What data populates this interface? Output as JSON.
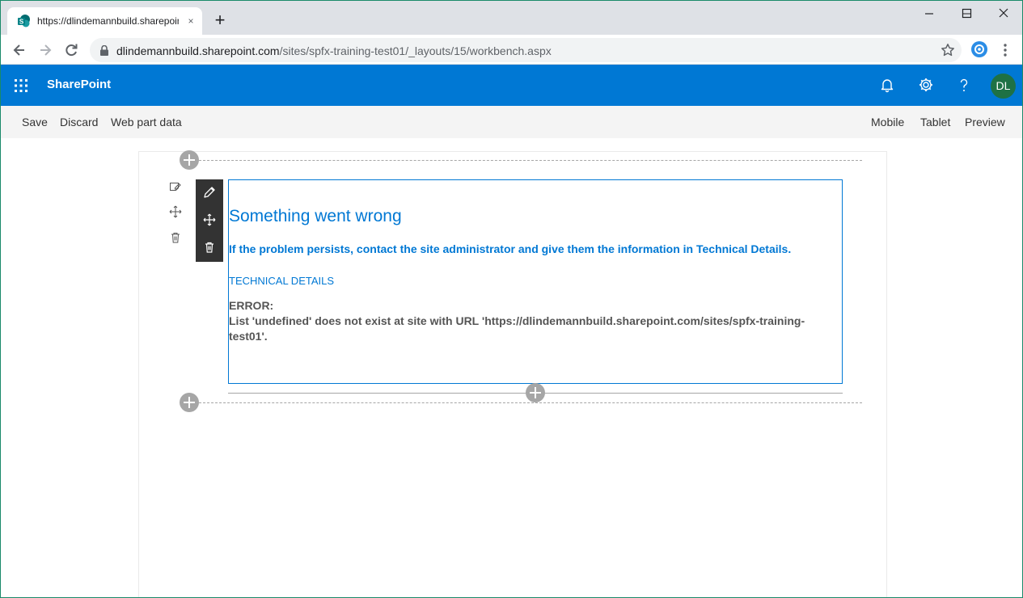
{
  "browser": {
    "tab_title": "https://dlindemannbuild.sharepoint.com/sites/spfx-training-test01/_layouts/15/workbench.aspx",
    "tab_close": "×",
    "new_tab": "+",
    "url_host": "dlindemannbuild.sharepoint.com",
    "url_path": "/sites/spfx-training-test01/_layouts/15/workbench.aspx",
    "window_controls": [
      "minimize",
      "maximize",
      "close"
    ],
    "favicon_letter": "S"
  },
  "suite": {
    "brand": "SharePoint",
    "avatar_initials": "DL",
    "accent": "#0078d4",
    "avatar_color": "#1e7145"
  },
  "commandbar": {
    "left": [
      "Save",
      "Discard",
      "Web part data"
    ],
    "right": [
      "Mobile",
      "Tablet",
      "Preview"
    ]
  },
  "webpart": {
    "title": "Something went wrong",
    "message": "If the problem persists, contact the site administrator and give them the information in Technical Details.",
    "technical_label": "TECHNICAL DETAILS",
    "error_label": "ERROR:",
    "error_detail": "List 'undefined' does not exist at site with URL 'https://dlindemannbuild.sharepoint.com/sites/spfx-training-test01'."
  },
  "icons": {
    "section_edit": "edit-section-icon",
    "section_move": "move-icon",
    "section_delete": "trash-icon",
    "webpart_edit": "pencil-icon",
    "webpart_move": "move-icon",
    "webpart_delete": "trash-icon"
  }
}
